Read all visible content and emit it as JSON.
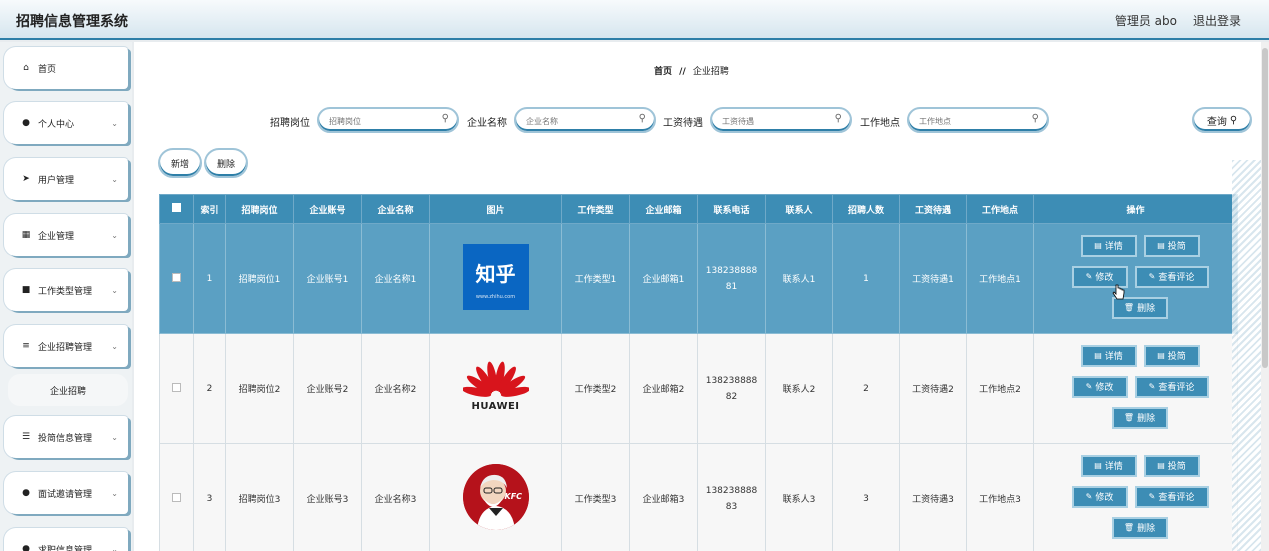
{
  "header": {
    "title": "招聘信息管理系统",
    "user": "管理员 abo",
    "logout": "退出登录"
  },
  "sidebar": {
    "items": [
      {
        "label": "首页",
        "icon": "home-icon",
        "glyph": "⌂",
        "has_chevron": false
      },
      {
        "label": "个人中心",
        "icon": "user-icon",
        "glyph": "●",
        "has_chevron": true
      },
      {
        "label": "用户管理",
        "icon": "send-icon",
        "glyph": "➤",
        "has_chevron": true
      },
      {
        "label": "企业管理",
        "icon": "grid-icon",
        "glyph": "▦",
        "has_chevron": true
      },
      {
        "label": "工作类型管理",
        "icon": "briefcase-icon",
        "glyph": "■",
        "has_chevron": true
      },
      {
        "label": "企业招聘管理",
        "icon": "sliders-icon",
        "glyph": "≡",
        "has_chevron": true
      },
      {
        "label": "投简信息管理",
        "icon": "list-icon",
        "glyph": "☰",
        "has_chevron": true
      },
      {
        "label": "面试邀请管理",
        "icon": "location-icon",
        "glyph": "●",
        "has_chevron": true
      },
      {
        "label": "求职信息管理",
        "icon": "user-icon",
        "glyph": "●",
        "has_chevron": true
      }
    ],
    "submenu": {
      "label": "企业招聘"
    }
  },
  "breadcrumb": {
    "home": "首页",
    "sep": "//",
    "current": "企业招聘"
  },
  "search": {
    "fields": [
      {
        "label": "招聘岗位",
        "placeholder": "招聘岗位"
      },
      {
        "label": "企业名称",
        "placeholder": "企业名称"
      },
      {
        "label": "工资待遇",
        "placeholder": "工资待遇"
      },
      {
        "label": "工作地点",
        "placeholder": "工作地点"
      }
    ],
    "query_label": "查询"
  },
  "actions": {
    "add": "新增",
    "delete": "删除"
  },
  "table": {
    "columns": [
      "索引",
      "招聘岗位",
      "企业账号",
      "企业名称",
      "图片",
      "工作类型",
      "企业邮箱",
      "联系电话",
      "联系人",
      "招聘人数",
      "工资待遇",
      "工作地点",
      "操作"
    ],
    "rows": [
      {
        "index": "1",
        "position": "招聘岗位1",
        "account": "企业账号1",
        "company": "企业名称1",
        "logo": "zhihu",
        "logo_text": "知乎",
        "logo_sub": "www.zhihu.com",
        "type": "工作类型1",
        "email": "企业邮箱1",
        "phone": "138238888\n81",
        "contact": "联系人1",
        "count": "1",
        "salary": "工资待遇1",
        "location": "工作地点1",
        "highlighted": true
      },
      {
        "index": "2",
        "position": "招聘岗位2",
        "account": "企业账号2",
        "company": "企业名称2",
        "logo": "huawei",
        "logo_text": "HUAWEI",
        "type": "工作类型2",
        "email": "企业邮箱2",
        "phone": "138238888\n82",
        "contact": "联系人2",
        "count": "2",
        "salary": "工资待遇2",
        "location": "工作地点2",
        "highlighted": false
      },
      {
        "index": "3",
        "position": "招聘岗位3",
        "account": "企业账号3",
        "company": "企业名称3",
        "logo": "kfc",
        "logo_text": "KFC",
        "type": "工作类型3",
        "email": "企业邮箱3",
        "phone": "138238888\n83",
        "contact": "联系人3",
        "count": "3",
        "salary": "工资待遇3",
        "location": "工作地点3",
        "highlighted": false
      }
    ],
    "ops": {
      "detail": "详情",
      "apply": "投简",
      "edit": "修改",
      "comments": "查看评论",
      "delete": "删除"
    }
  },
  "colors": {
    "accent": "#3d8db5",
    "header_border": "#2e7fa8",
    "row_highlight": "#5ba0c3"
  }
}
